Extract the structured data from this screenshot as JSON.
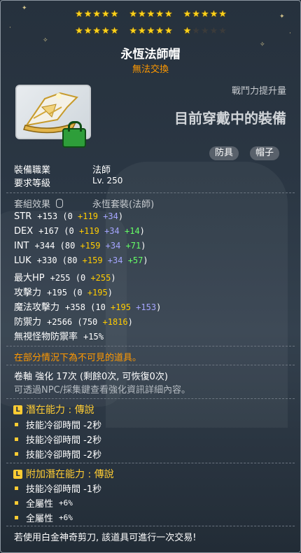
{
  "stars": {
    "row1": [
      5,
      5,
      5
    ],
    "row2": {
      "filled": 11,
      "empty": 4
    }
  },
  "item": {
    "name": "永恆法師帽",
    "trade_status": "無法交換",
    "icon": "eternal-mage-hat-icon",
    "lock_icon": "locked-icon"
  },
  "combat_power": {
    "label": "戰鬥力提升量",
    "value": "目前穿戴中的裝備"
  },
  "tags": [
    "防具",
    "帽子"
  ],
  "info": {
    "job_label": "裝備職業",
    "job_value": "法師",
    "level_label": "要求等級",
    "level_value": "Lv. 250",
    "set_label": "套組效果",
    "set_value": "永恆套裝(法師)"
  },
  "stats": [
    {
      "name": "STR",
      "total": "+153",
      "parts": [
        {
          "t": " (0 ",
          "c": ""
        },
        {
          "t": "+119",
          "c": "yel"
        },
        {
          "t": " +34",
          "c": "blu"
        },
        {
          "t": ")",
          "c": ""
        }
      ]
    },
    {
      "name": "DEX",
      "total": "+167",
      "parts": [
        {
          "t": " (0 ",
          "c": ""
        },
        {
          "t": "+119",
          "c": "yel"
        },
        {
          "t": " +34",
          "c": "blu"
        },
        {
          "t": " +14",
          "c": "grn"
        },
        {
          "t": ")",
          "c": ""
        }
      ]
    },
    {
      "name": "INT",
      "total": "+344",
      "parts": [
        {
          "t": " (80 ",
          "c": ""
        },
        {
          "t": "+159",
          "c": "yel"
        },
        {
          "t": " +34",
          "c": "blu"
        },
        {
          "t": " +71",
          "c": "grn"
        },
        {
          "t": ")",
          "c": ""
        }
      ]
    },
    {
      "name": "LUK",
      "total": "+330",
      "parts": [
        {
          "t": " (80 ",
          "c": ""
        },
        {
          "t": "+159",
          "c": "yel"
        },
        {
          "t": " +34",
          "c": "blu"
        },
        {
          "t": " +57",
          "c": "grn"
        },
        {
          "t": ")",
          "c": ""
        }
      ]
    },
    {
      "name": "最大HP",
      "total": "+255",
      "parts": [
        {
          "t": " (0 ",
          "c": ""
        },
        {
          "t": "+255",
          "c": "yel"
        },
        {
          "t": ")",
          "c": ""
        }
      ]
    },
    {
      "name": "攻擊力",
      "total": "+195",
      "parts": [
        {
          "t": " (0 ",
          "c": ""
        },
        {
          "t": "+195",
          "c": "yel"
        },
        {
          "t": ")",
          "c": ""
        }
      ]
    },
    {
      "name": "魔法攻擊力",
      "total": "+358",
      "parts": [
        {
          "t": " (10 ",
          "c": ""
        },
        {
          "t": "+195",
          "c": "yel"
        },
        {
          "t": " +153",
          "c": "blu"
        },
        {
          "t": ")",
          "c": ""
        }
      ]
    },
    {
      "name": "防禦力",
      "total": "+2566",
      "parts": [
        {
          "t": " (750 ",
          "c": ""
        },
        {
          "t": "+1816",
          "c": "yel"
        },
        {
          "t": ")",
          "c": ""
        }
      ]
    },
    {
      "name": "無視怪物防禦率",
      "total": "+15%",
      "parts": []
    }
  ],
  "notice": "在部分情況下為不可見的道具。",
  "scroll": {
    "line": "卷軸 強化 17次 (剩餘0次, 可恢復0次)",
    "hint": "可透過NPC/採集鍵查看強化資訊詳細內容。"
  },
  "potential": {
    "badge": "L",
    "title": "潛在能力 : 傳說",
    "lines": [
      "技能冷卻時間 -2秒",
      "技能冷卻時間 -2秒",
      "技能冷卻時間 -2秒"
    ]
  },
  "bonus_potential": {
    "badge": "L",
    "title": "附加潛在能力 : 傳說",
    "lines": [
      {
        "label": "技能冷卻時間 -1秒",
        "pct": ""
      },
      {
        "label": "全屬性",
        "pct": "+6%"
      },
      {
        "label": "全屬性",
        "pct": "+6%"
      }
    ]
  },
  "footer": "若使用白金神奇剪刀, 該道具可進行一次交易!",
  "colors": {
    "gold": "#ffcc00",
    "orange": "#ff9900",
    "blue": "#a5a5ff",
    "green": "#66ff66"
  }
}
